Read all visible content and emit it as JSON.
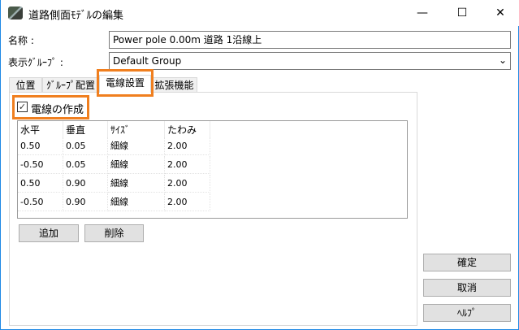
{
  "window": {
    "title": "道路側面ﾓﾃﾞﾙの編集",
    "minimize": "—",
    "maximize": "☐",
    "close": "✕"
  },
  "form": {
    "name_label": "名称 :",
    "name_value": "Power pole 0.00m 道路 1沿線上",
    "group_label": "表示ｸﾞﾙｰﾌﾟ :",
    "group_value": "Default Group"
  },
  "tabs": [
    {
      "label": "位置"
    },
    {
      "label": "ｸﾞﾙｰﾌﾟ配置"
    },
    {
      "label": "電線設置"
    },
    {
      "label": "拡張機能"
    }
  ],
  "wire": {
    "create_label": "電線の作成",
    "create_checked": true
  },
  "table": {
    "headers": [
      "水平",
      "垂直",
      "ｻｲｽﾞ",
      "たわみ"
    ],
    "rows": [
      [
        "0.50",
        "0.05",
        "細線",
        "2.00"
      ],
      [
        "-0.50",
        "0.05",
        "細線",
        "2.00"
      ],
      [
        "0.50",
        "0.90",
        "細線",
        "2.00"
      ],
      [
        "-0.50",
        "0.90",
        "細線",
        "2.00"
      ]
    ]
  },
  "buttons": {
    "add": "追加",
    "delete": "削除",
    "ok": "確定",
    "cancel": "取消",
    "help": "ﾍﾙﾌﾟ"
  }
}
